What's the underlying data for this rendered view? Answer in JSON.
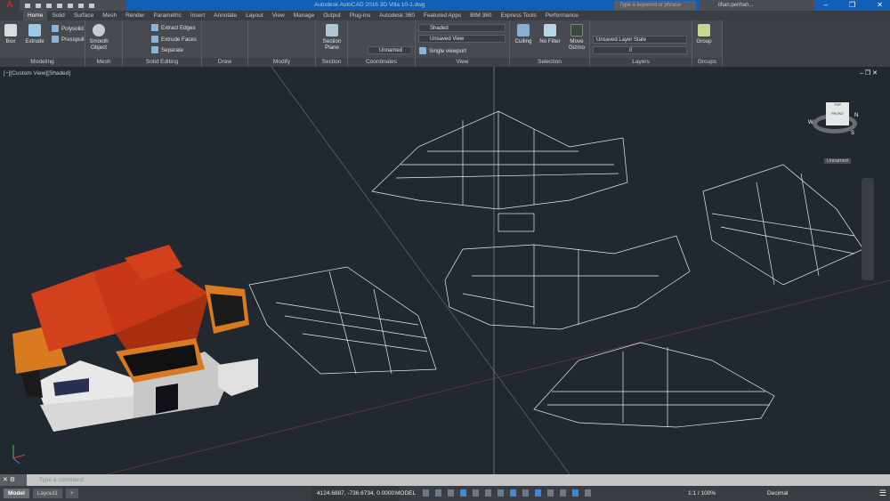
{
  "app": {
    "title": "Autodesk AutoCAD 2016   3D Villa 10-1.dwg",
    "logo": "A",
    "search_placeholder": "Type a keyword or phrase",
    "user": "ilhan.perihan..."
  },
  "tabs": [
    "Home",
    "Solid",
    "Surface",
    "Mesh",
    "Render",
    "Parametric",
    "Insert",
    "Annotate",
    "Layout",
    "View",
    "Manage",
    "Output",
    "Plug-ins",
    "Autodesk 360",
    "Featured Apps",
    "BIM 360",
    "Express Tools",
    "Performance"
  ],
  "ribbon": {
    "modeling": {
      "label": "Modeling",
      "box": "Box",
      "extrude": "Extrude",
      "polysolid": "Polysolid",
      "presspull": "Presspull"
    },
    "mesh": {
      "label": "Mesh",
      "smooth": "Smooth Object"
    },
    "solid_editing": {
      "label": "Solid Editing",
      "extract_edges": "Extract Edges",
      "extrude_faces": "Extrude Faces",
      "separate": "Separate"
    },
    "draw": {
      "label": "Draw"
    },
    "modify": {
      "label": "Modify"
    },
    "section": {
      "label": "Section",
      "section_plane": "Section Plane"
    },
    "coordinates": {
      "label": "Coordinates",
      "ucs": "Unnamed"
    },
    "view": {
      "label": "View",
      "visual_style": "Shaded",
      "named_view": "Unsaved View",
      "viewport": "Single viewport"
    },
    "selection": {
      "label": "Selection",
      "culling": "Culling",
      "no_filter": "No Filter",
      "move_gizmo": "Move Gizmo"
    },
    "layers": {
      "label": "Layers",
      "layer_state": "Unsaved Layer State",
      "current_layer": "0"
    },
    "groups": {
      "label": "Groups",
      "group": "Group"
    }
  },
  "viewport": {
    "label": "[−][Custom View][Shaded]",
    "viewcube": {
      "top": "TOP",
      "front": "FRONT",
      "n": "N",
      "w": "W",
      "s": "S",
      "wcs": "Unnamed"
    }
  },
  "command": {
    "placeholder": "Type a command"
  },
  "status": {
    "layouts": [
      "Model",
      "Layout1"
    ],
    "coords": "4124.6887, -736.6734, 0.0000",
    "space": "MODEL",
    "scale": "1:1 / 100%",
    "units": "Decimal"
  },
  "colors": {
    "titlebar": "#1160b8",
    "ribbon": "#474b51",
    "canvas": "#212830",
    "roof": "#d2401c"
  }
}
